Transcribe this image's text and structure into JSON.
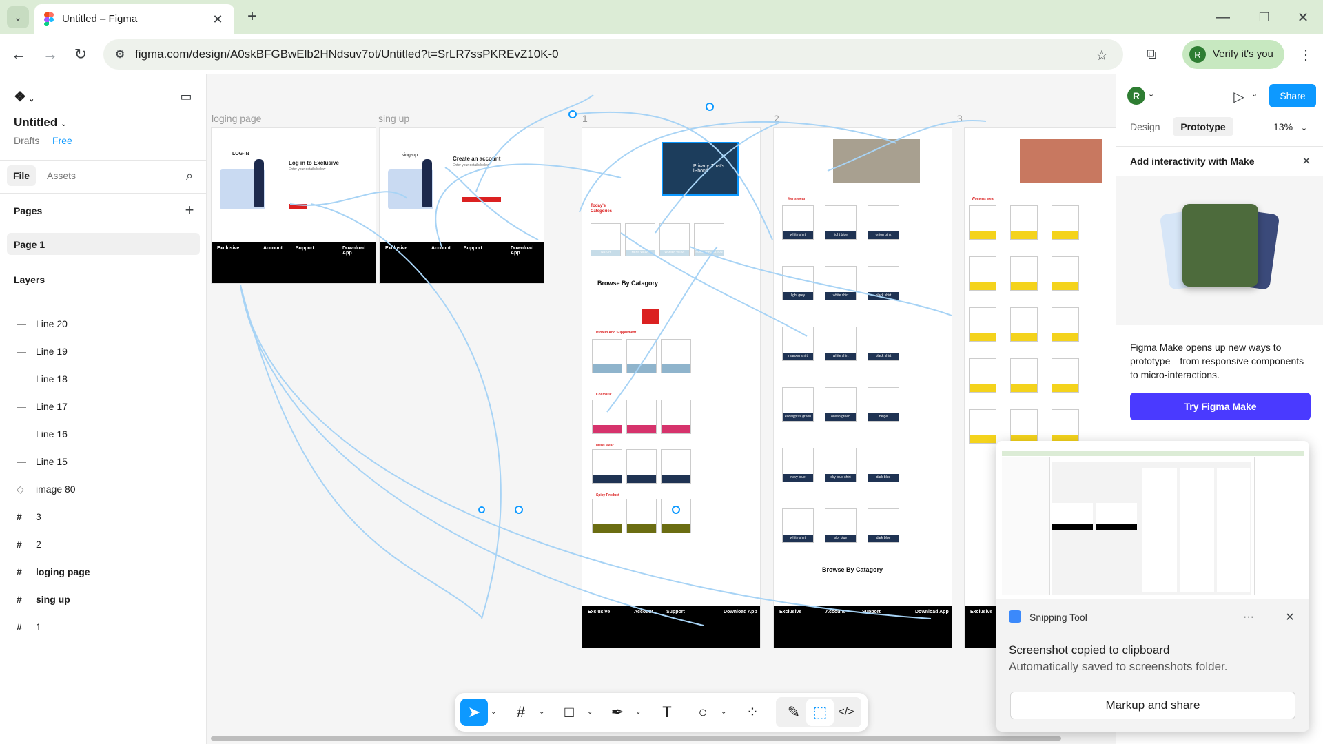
{
  "browser": {
    "tab_title": "Untitled – Figma",
    "url": "figma.com/design/A0skBFGBwElb2HNdsuv7ot/Untitled?t=SrLR7ssPKREvZ10K-0",
    "verify_label": "Verify it's you",
    "profile_initial": "R"
  },
  "figma": {
    "file_name": "Untitled",
    "drafts_label": "Drafts",
    "plan_label": "Free",
    "tabs": [
      "File",
      "Assets"
    ],
    "pages_label": "Pages",
    "pages": [
      "Page 1"
    ],
    "layers_label": "Layers",
    "layers": [
      {
        "icon": "line",
        "name": "Line 20"
      },
      {
        "icon": "line",
        "name": "Line 19"
      },
      {
        "icon": "line",
        "name": "Line 18"
      },
      {
        "icon": "line",
        "name": "Line 17"
      },
      {
        "icon": "line",
        "name": "Line 16"
      },
      {
        "icon": "line",
        "name": "Line 15"
      },
      {
        "icon": "image",
        "name": "image 80"
      },
      {
        "icon": "frame",
        "name": "3"
      },
      {
        "icon": "frame",
        "name": "2"
      },
      {
        "icon": "frame",
        "name": "loging page"
      },
      {
        "icon": "frame",
        "name": "sing up"
      },
      {
        "icon": "frame",
        "name": "1"
      }
    ]
  },
  "right_panel": {
    "avatar_initial": "R",
    "share_label": "Share",
    "tabs": [
      "Design",
      "Prototype"
    ],
    "zoom": "13%",
    "make_title": "Add interactivity with Make",
    "make_desc": "Figma Make opens up new ways to prototype—from responsive components to micro-interactions.",
    "make_button": "Try Figma Make"
  },
  "canvas": {
    "frame_labels": [
      "loging page",
      "sing up",
      "1",
      "2",
      "3"
    ],
    "login": {
      "logo": "LOG-IN",
      "title": "Log in to Exclusive",
      "subtitle": "Enter your details below"
    },
    "signup": {
      "logo": "sing-up",
      "title": "Create an account",
      "subtitle": "Enter your details below"
    },
    "sections": {
      "browse1": "Browse By Catagory",
      "browse2": "Browse By Catagory",
      "todays": "Today's",
      "categories": "Categories",
      "protein": "Protein And Supplement",
      "cosmatic": "Cosmatic",
      "menswear": "Mens wear",
      "spicy": "Spicy Product",
      "mens_wear2": "Mens wear",
      "womens_wear": "Womens wear"
    },
    "cat_labels": [
      "WATCH",
      "MENS WEAR",
      "WOMEN WEAR",
      "HOME APPLICATION"
    ],
    "shirts": [
      [
        "white shirt",
        "light blue",
        "onion pink"
      ],
      [
        "light grey",
        "white shirt",
        "black shirt"
      ],
      [
        "maroon shirt",
        "white shirt",
        "black shirt"
      ],
      [
        "eucalyptus green",
        "ocean green",
        "beige"
      ],
      [
        "navy blue",
        "sky blue shirt",
        "dark blue"
      ],
      [
        "white shirt",
        "sky blue",
        "dark blue"
      ]
    ],
    "footer": {
      "brand": "Exclusive",
      "account": "Account",
      "support": "Support",
      "download": "Download App"
    },
    "hero_text": "Privacy. That's iPhone."
  },
  "snipping": {
    "app": "Snipping Tool",
    "title": "Screenshot copied to clipboard",
    "subtitle": "Automatically saved to screenshots folder.",
    "button": "Markup and share"
  },
  "colors": {
    "accent": "#0d99ff",
    "share": "#0d99ff",
    "make": "#4a3aff",
    "tabbar": "#dcecd6",
    "link": "#a7d3f5"
  }
}
